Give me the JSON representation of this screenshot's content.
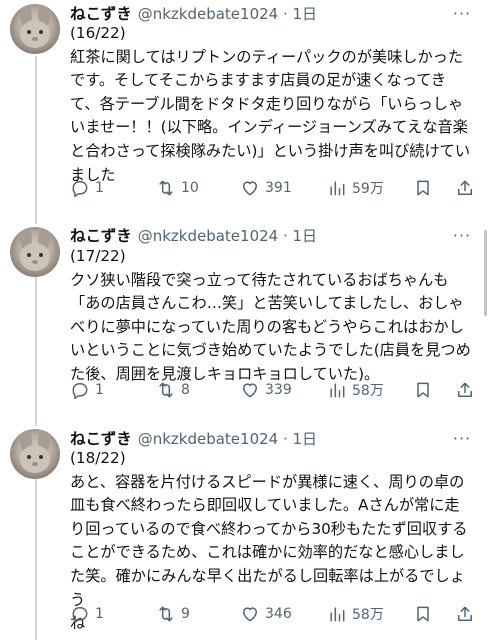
{
  "tweets": [
    {
      "name": "ねこずき",
      "handle": "@nkzkdebate1024 · 1日",
      "text": "(16/22)\n紅茶に関してはリプトンのティーパックのが美味しかった\nです。そしてそこからますます店員の足が速くなってき\nて、各テーブル間をドタドタ走り回りながら「いらっしゃ\nいませー！！(以下略。インディージョーンズみてえな音楽\nと合わさって探検隊みたい)」という掛け声を叫び続けてい\nました",
      "replies": "1",
      "retweets": "10",
      "likes": "391",
      "views": "59万"
    },
    {
      "name": "ねこずき",
      "handle": "@nkzkdebate1024 · 1日",
      "text": "(17/22)\nクソ狭い階段で突っ立って待たされているおばちゃんも\n「あの店員さんこわ…笑」と苦笑いしてましたし、おしゃ\nべりに夢中になっていた周りの客もどうやらこれはおかし\nいということに気づき始めていたようでした(店員を見つめ\nた後、周囲を見渡しキョロキョロしていた)。",
      "replies": "1",
      "retweets": "8",
      "likes": "339",
      "views": "58万"
    },
    {
      "name": "ねこずき",
      "handle": "@nkzkdebate1024 · 1日",
      "text": "(18/22)\nあと、容器を片付けるスピードが異様に速く、周りの卓の\n皿も食べ終わったら即回収していました。Aさんが常に走\nり回っているので食べ終わってから30秒もたたず回収する\nことができるため、これは確かに効率的だなと感心しまし\nた笑。確かにみんな早く出たがるし回転率は上がるでしょう\nね",
      "replies": "1",
      "retweets": "9",
      "likes": "346",
      "views": "58万"
    }
  ],
  "icons": {
    "more": "more-icon",
    "reply": "reply-icon",
    "retweet": "retweet-icon",
    "like": "heart-icon",
    "views": "views-icon",
    "bookmark": "bookmark-icon",
    "share": "share-icon"
  },
  "colors": {
    "text": "#0f1419",
    "secondary": "#536471",
    "thread_line": "#cfd9de"
  }
}
